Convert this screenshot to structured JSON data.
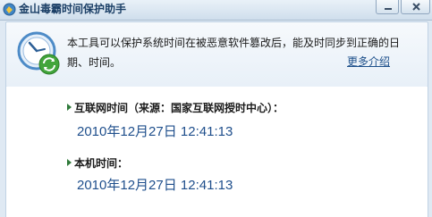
{
  "window": {
    "title": "金山毒霸时间保护助手"
  },
  "banner": {
    "description": "本工具可以保护系统时间在被恶意软件篡改后，能及时同步到正确的日期、时间。",
    "more_link": "更多介绍"
  },
  "internet_time": {
    "label": "互联网时间（来源：国家互联网授时中心）：",
    "value": "2010年12月27日 12:41:13"
  },
  "local_time": {
    "label": "本机时间：",
    "value": "2010年12月27日 12:41:13"
  },
  "colors": {
    "title_text": "#1b3f66",
    "time_value": "#1f4f8c",
    "link": "#1d4f8a",
    "arrow": "#2f7a3a"
  },
  "icons": {
    "title": "kingsoft-shield-icon",
    "banner": "clock-sync-icon"
  }
}
